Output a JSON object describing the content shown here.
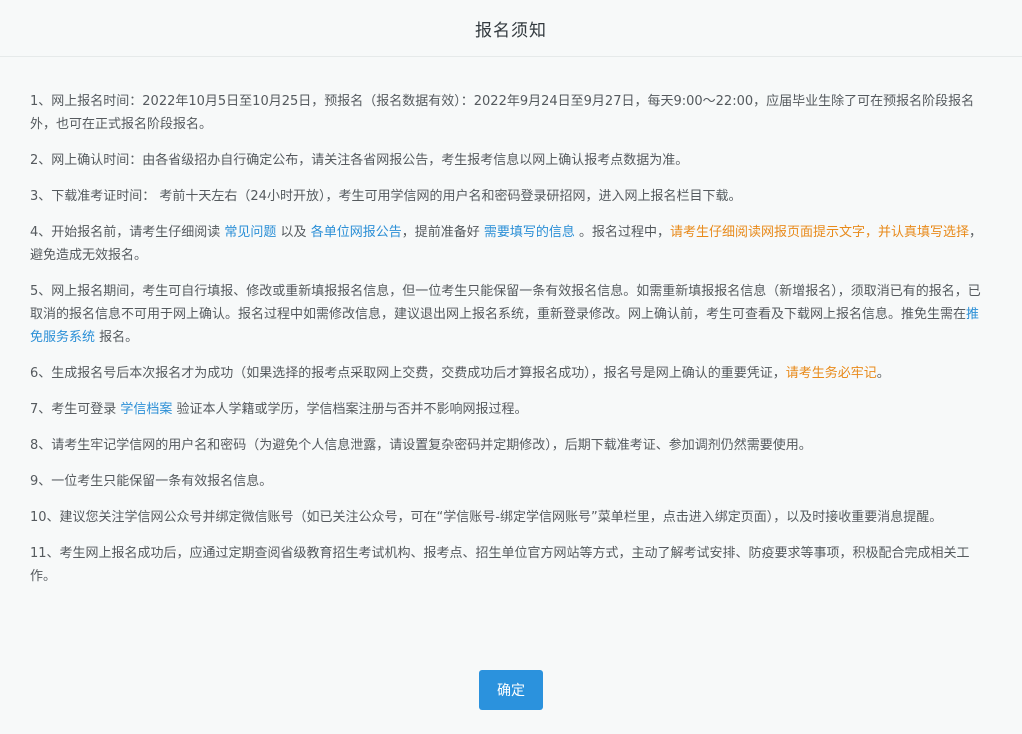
{
  "dialog": {
    "title": "报名须知",
    "confirm_label": "确定"
  },
  "notice": {
    "item1": "1、网上报名时间：2022年10月5日至10月25日，预报名（报名数据有效）：2022年9月24日至9月27日，每天9:00～22:00，应届毕业生除了可在预报名阶段报名外，也可在正式报名阶段报名。",
    "item2": "2、网上确认时间：由各省级招办自行确定公布，请关注各省网报公告，考生报考信息以网上确认报考点数据为准。",
    "item3": "3、下载准考证时间： 考前十天左右（24小时开放），考生可用学信网的用户名和密码登录研招网，进入网上报名栏目下载。",
    "item4": {
      "t1": "4、开始报名前，请考生仔细阅读 ",
      "link1": "常见问题",
      "t2": " 以及 ",
      "link2": "各单位网报公告",
      "t3": "，提前准备好 ",
      "link3": "需要填写的信息",
      "t4": " 。报名过程中，",
      "warn": "请考生仔细阅读网报页面提示文字，并认真填写选择",
      "t5": "，避免造成无效报名。"
    },
    "item5": {
      "t1": "5、网上报名期间，考生可自行填报、修改或重新填报报名信息，但一位考生只能保留一条有效报名信息。如需重新填报报名信息（新增报名），须取消已有的报名，已取消的报名信息不可用于网上确认。报名过程中如需修改信息，建议退出网上报名系统，重新登录修改。网上确认前，考生可查看及下载网上报名信息。推免生需在",
      "link": "推免服务系统",
      "t2": " 报名。"
    },
    "item6": {
      "t1": "6、生成报名号后本次报名才为成功（如果选择的报考点采取网上交费，交费成功后才算报名成功），报名号是网上确认的重要凭证，",
      "warn": "请考生务必牢记",
      "t2": "。"
    },
    "item7": {
      "t1": "7、考生可登录 ",
      "link": "学信档案",
      "t2": " 验证本人学籍或学历，学信档案注册与否并不影响网报过程。"
    },
    "item8": "8、请考生牢记学信网的用户名和密码（为避免个人信息泄露，请设置复杂密码并定期修改），后期下载准考证、参加调剂仍然需要使用。",
    "item9": "9、一位考生只能保留一条有效报名信息。",
    "item10": "10、建议您关注学信网公众号并绑定微信账号（如已关注公众号，可在“学信账号-绑定学信网账号”菜单栏里，点击进入绑定页面），以及时接收重要消息提醒。",
    "item11": "11、考生网上报名成功后，应通过定期查阅省级教育招生考试机构、报考点、招生单位官方网站等方式，主动了解考试安排、防疫要求等事项，积极配合完成相关工作。"
  },
  "colors": {
    "link": "#2b8fd6",
    "warning": "#e88a1a",
    "button": "#2b92dd",
    "text": "#555a5e"
  }
}
